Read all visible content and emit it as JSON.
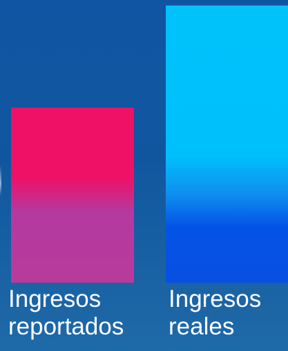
{
  "chart_data": {
    "type": "bar",
    "categories": [
      "Ingresos reportados",
      "Ingresos reales"
    ],
    "category_lines": [
      [
        "Ingresos",
        "reportados"
      ],
      [
        "Ingresos",
        "reales"
      ]
    ],
    "values": [
      63,
      100
    ],
    "title": "",
    "xlabel": "",
    "ylabel": "",
    "ylim": [
      0,
      100
    ],
    "grid": false,
    "legend": "none",
    "colors": {
      "bar_0": [
        "#ee1166",
        "#b83a9c"
      ],
      "bar_1": [
        "#00c2fb",
        "#0750e2"
      ],
      "background": "#10569f"
    }
  }
}
